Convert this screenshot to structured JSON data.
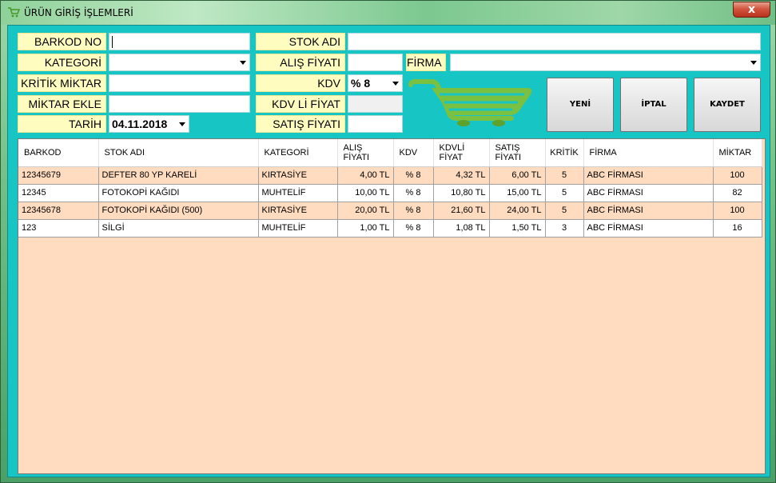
{
  "window": {
    "title": "ÜRÜN GİRİŞ İŞLEMLERİ",
    "close_label": "x",
    "client_color": "#17c5c5",
    "label_color": "#fffcc0"
  },
  "form": {
    "barkod_label": "BARKOD NO",
    "barkod_value": "",
    "kategori_label": "KATEGORİ",
    "kategori_value": "",
    "kritik_label": "KRİTİK MİKTAR",
    "kritik_value": "",
    "miktar_label": "MİKTAR EKLE",
    "miktar_value": "",
    "tarih_label": "TARİH",
    "tarih_value": "04.11.2018",
    "stok_label": "STOK ADI",
    "stok_value": "",
    "alis_label": "ALIŞ FİYATI",
    "alis_value": "",
    "firma_label": "FİRMA",
    "firma_value": "",
    "kdv_label": "KDV",
    "kdv_value": "% 8",
    "kdvli_label": "KDV Lİ FİYAT",
    "kdvli_value": "",
    "satis_label": "SATIŞ FİYATI",
    "satis_value": ""
  },
  "buttons": {
    "yeni": "YENİ",
    "iptal": "İPTAL",
    "kaydet": "KAYDET"
  },
  "icons": {
    "title": "cart-icon",
    "logo": "shopping-cart-icon",
    "cart_color": "#7ac142"
  },
  "grid": {
    "columns": [
      "BARKOD",
      "STOK ADI",
      "KATEGORİ",
      "ALIŞ FİYATI",
      "KDV",
      "KDVLİ FİYAT",
      "SATIŞ FİYATI",
      "KRİTİK",
      "FİRMA",
      "MİKTAR"
    ],
    "col_lines": [
      [
        "BARKOD"
      ],
      [
        "STOK ADI"
      ],
      [
        "KATEGORİ"
      ],
      [
        "ALIŞ",
        "FİYATI"
      ],
      [
        "KDV"
      ],
      [
        "KDVLİ",
        "FİYAT"
      ],
      [
        "SATIŞ",
        "FİYATI"
      ],
      [
        "KRİTİK"
      ],
      [
        "FİRMA"
      ],
      [
        "MİKTAR"
      ]
    ],
    "rows": [
      [
        "12345679",
        "DEFTER 80 YP KARELİ",
        "KIRTASİYE",
        "4,00 TL",
        "% 8",
        "4,32 TL",
        "6,00 TL",
        "5",
        "ABC FİRMASI",
        "100"
      ],
      [
        "12345",
        "FOTOKOPİ KAĞIDI",
        "MUHTELİF",
        "10,00 TL",
        "% 8",
        "10,80 TL",
        "15,00 TL",
        "5",
        "ABC FİRMASI",
        "82"
      ],
      [
        "12345678",
        "FOTOKOPİ KAĞIDI (500)",
        "KIRTASİYE",
        "20,00 TL",
        "% 8",
        "21,60 TL",
        "24,00 TL",
        "5",
        "ABC FİRMASI",
        "100"
      ],
      [
        "123",
        "SİLGİ",
        "MUHTELİF",
        "1,00 TL",
        "% 8",
        "1,08 TL",
        "1,50 TL",
        "3",
        "ABC FİRMASI",
        "16"
      ]
    ],
    "row_colors": [
      "#ffdcbf",
      "#ffffff"
    ]
  }
}
